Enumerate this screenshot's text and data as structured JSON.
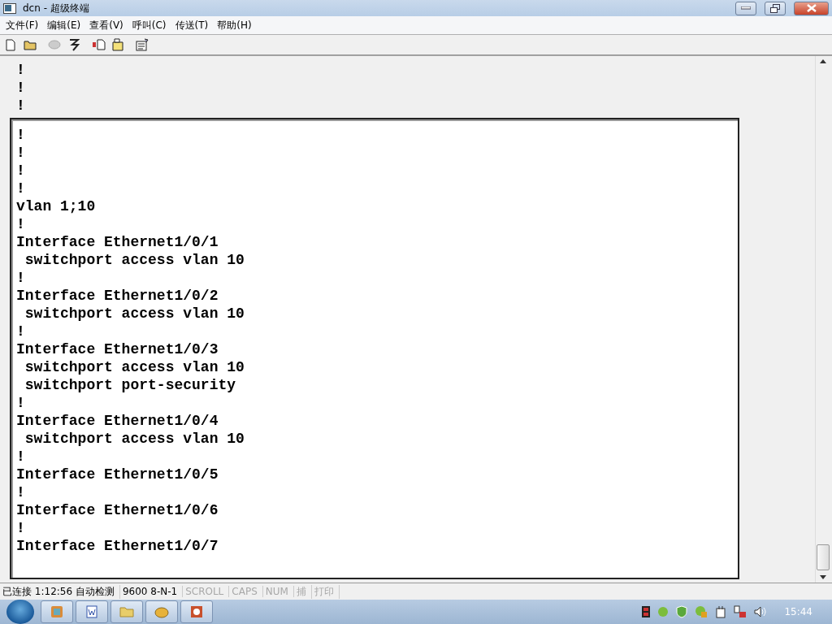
{
  "window": {
    "title": "dcn - 超级终端"
  },
  "menu": [
    {
      "label": "文件(F)"
    },
    {
      "label": "编辑(E)"
    },
    {
      "label": "查看(V)"
    },
    {
      "label": "呼叫(C)"
    },
    {
      "label": "传送(T)"
    },
    {
      "label": "帮助(H)"
    }
  ],
  "toolbar": [
    {
      "kind": "new",
      "disabled": false
    },
    {
      "kind": "open",
      "disabled": false
    },
    {
      "kind": "call",
      "disabled": true
    },
    {
      "kind": "hangup",
      "disabled": false
    },
    {
      "kind": "send",
      "disabled": false
    },
    {
      "kind": "receive",
      "disabled": false
    },
    {
      "kind": "properties",
      "disabled": false
    }
  ],
  "terminal": {
    "back_lines": [
      "!",
      "!",
      "!"
    ],
    "lines": [
      "!",
      "!",
      "!",
      "!",
      "vlan 1;10",
      "!",
      "Interface Ethernet1/0/1",
      " switchport access vlan 10",
      "!",
      "Interface Ethernet1/0/2",
      " switchport access vlan 10",
      "!",
      "Interface Ethernet1/0/3",
      " switchport access vlan 10",
      " switchport port-security",
      "!",
      "Interface Ethernet1/0/4",
      " switchport access vlan 10",
      "!",
      "Interface Ethernet1/0/5",
      "!",
      "Interface Ethernet1/0/6",
      "!",
      "Interface Ethernet1/0/7"
    ]
  },
  "status_bar": [
    {
      "text": "已连接 1:12:56 自动检测",
      "disabled": false
    },
    {
      "text": "9600 8-N-1",
      "disabled": false
    },
    {
      "text": "SCROLL",
      "disabled": true
    },
    {
      "text": "CAPS",
      "disabled": true
    },
    {
      "text": "NUM",
      "disabled": true
    },
    {
      "text": "捕",
      "disabled": true
    },
    {
      "text": "打印",
      "disabled": true
    }
  ],
  "taskbar": {
    "clock": "15:44"
  }
}
